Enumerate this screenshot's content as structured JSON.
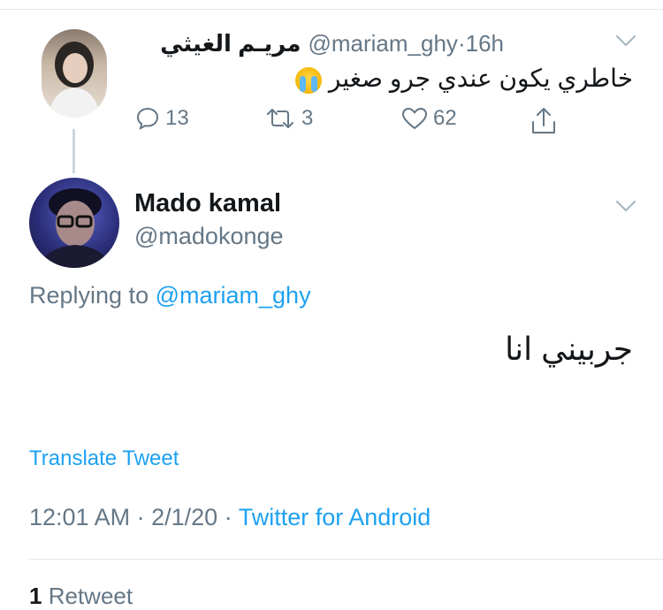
{
  "parent_tweet": {
    "display_name": "مريـم الغيثي",
    "handle": "@mariam_ghy",
    "separator": "·",
    "time": "16h",
    "text": "خاطري يكون عندي جرو صغير",
    "emoji": "loudly-crying-face",
    "reply_count": "13",
    "retweet_count": "3",
    "like_count": "62"
  },
  "main_tweet": {
    "display_name": "Mado kamal",
    "handle": "@madokonge",
    "replying_prefix": "Replying to",
    "replying_to": "@mariam_ghy",
    "text": "جربيني انا",
    "translate_label": "Translate Tweet",
    "time": "12:01 AM",
    "date": "2/1/20",
    "separator": "·",
    "client": "Twitter for Android",
    "retweet_count": "1",
    "retweet_label": "Retweet"
  },
  "colors": {
    "accent": "#1da1f2",
    "secondary_text": "#657786",
    "primary_text": "#14171a",
    "divider": "#e1e8ed"
  }
}
